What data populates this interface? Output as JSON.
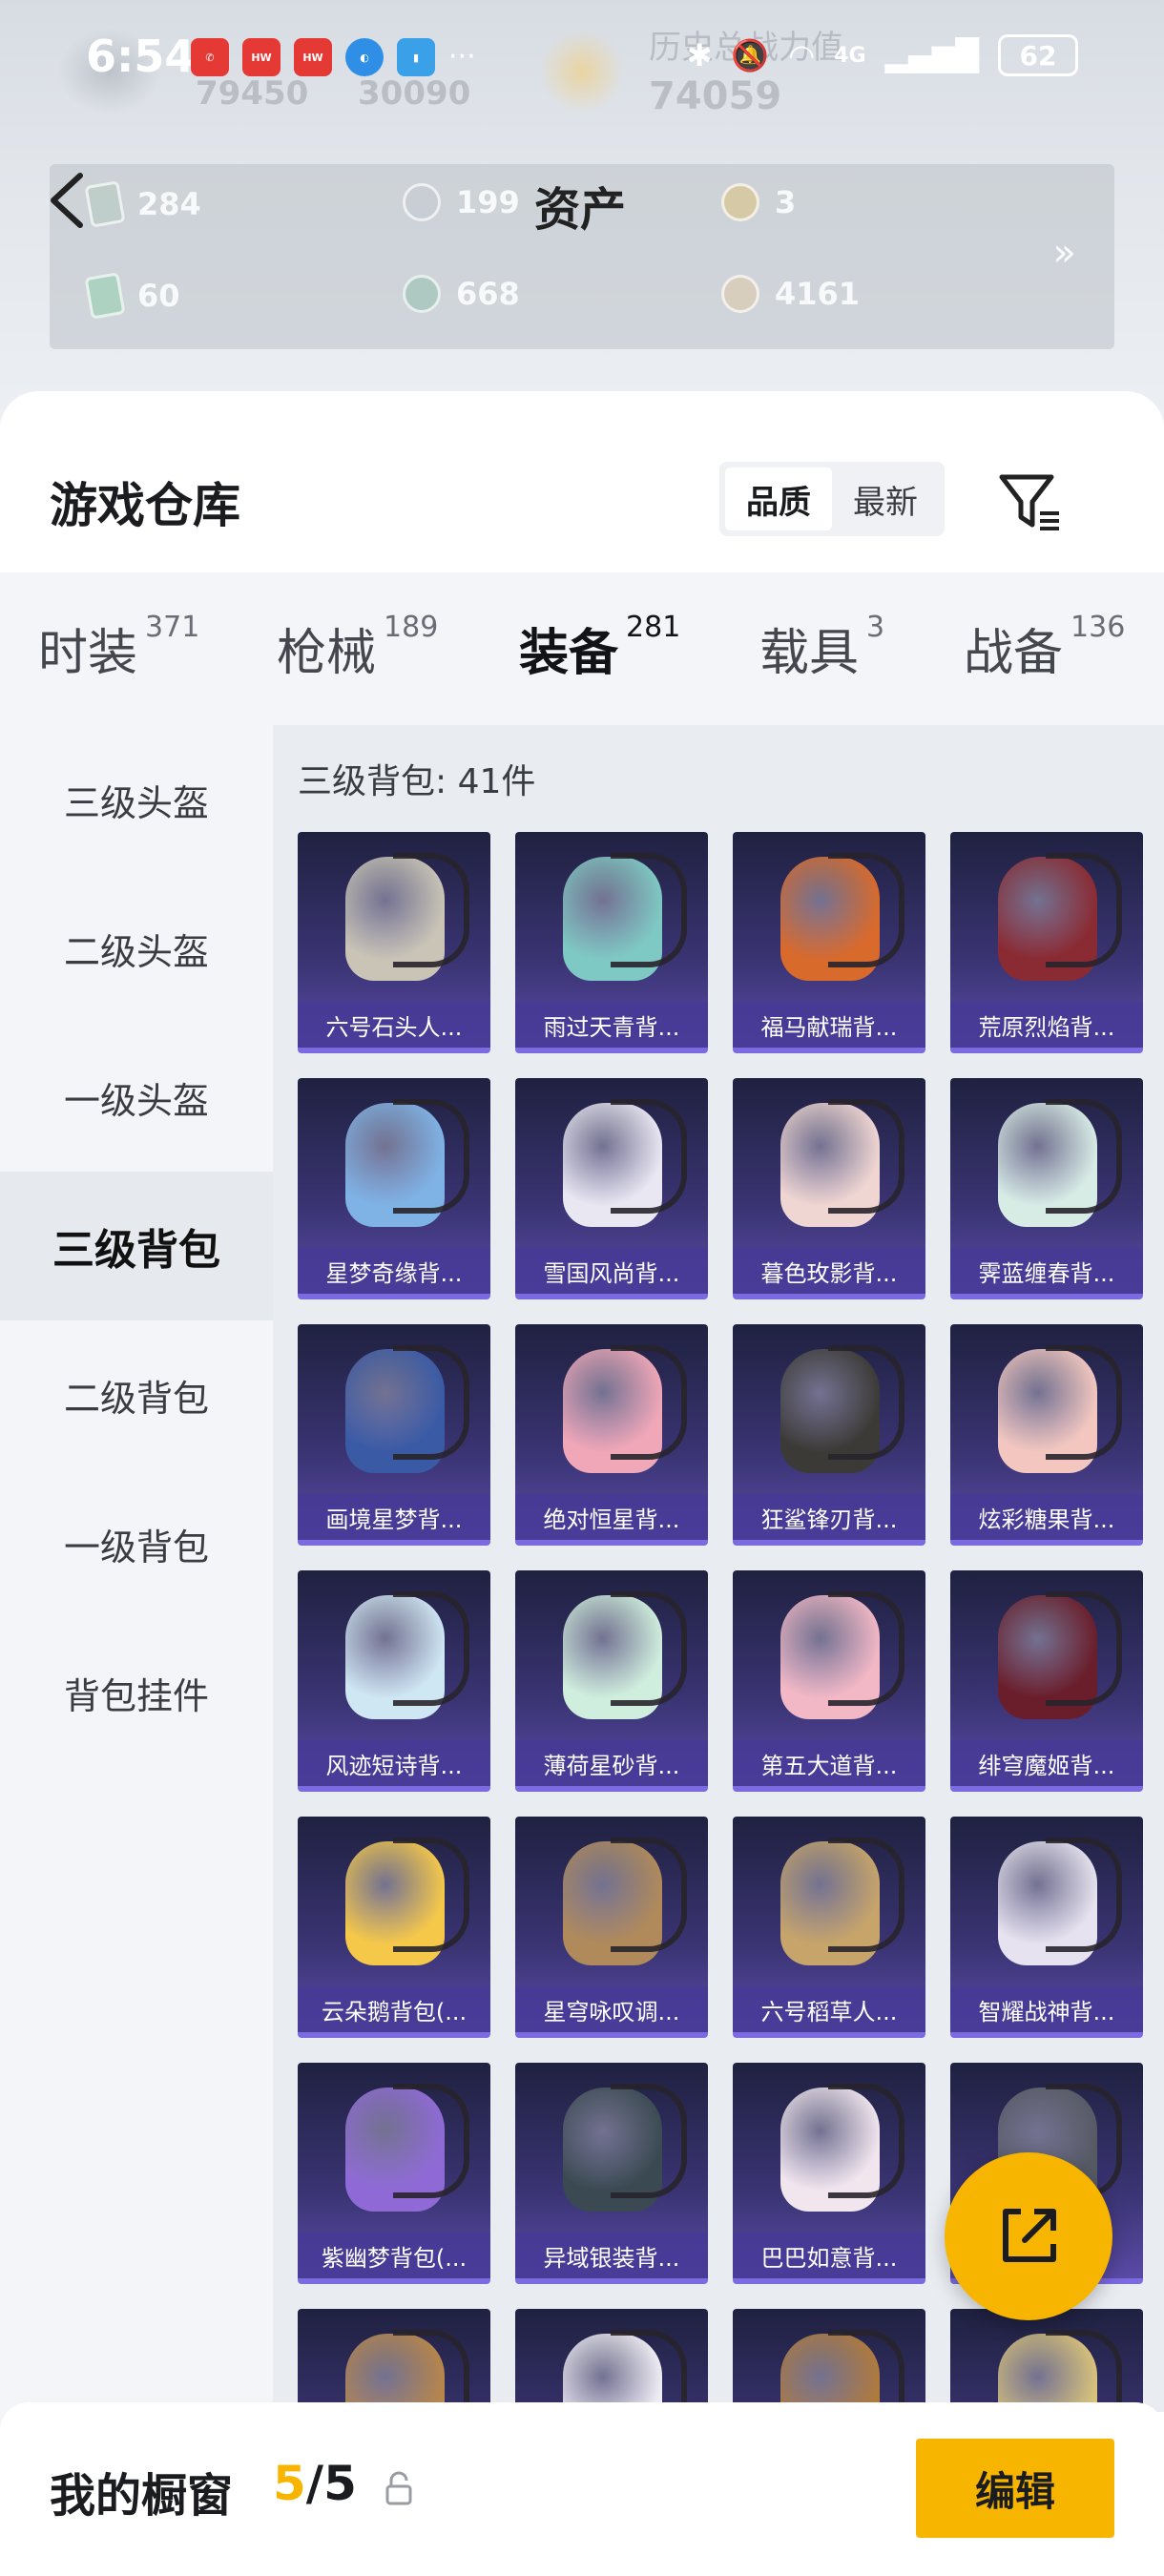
{
  "status_bar": {
    "time": "6:54",
    "battery": "62",
    "network": "4G"
  },
  "hero": {
    "title": "资产",
    "ghost_text_1": "历史总战力值",
    "ghost_text_2": "74059",
    "ghost_text_3": "79450",
    "ghost_text_4": "30090"
  },
  "assets": [
    {
      "value": "284",
      "icon": "card-icon"
    },
    {
      "value": "199",
      "icon": "coin-icon"
    },
    {
      "value": "3",
      "icon": "gold-coin-icon"
    },
    {
      "value": "60",
      "icon": "card-icon"
    },
    {
      "value": "668",
      "icon": "orb-icon"
    },
    {
      "value": "4161",
      "icon": "gold-coin-icon"
    }
  ],
  "warehouse": {
    "title": "游戏仓库",
    "sort_options": [
      "品质",
      "最新"
    ],
    "sort_selected": "品质"
  },
  "tabs": [
    {
      "label": "时装",
      "count": "371"
    },
    {
      "label": "枪械",
      "count": "189"
    },
    {
      "label": "装备",
      "count": "281",
      "active": true
    },
    {
      "label": "载具",
      "count": "3"
    },
    {
      "label": "战备",
      "count": "136"
    }
  ],
  "categories": [
    {
      "label": "三级头盔"
    },
    {
      "label": "二级头盔"
    },
    {
      "label": "一级头盔"
    },
    {
      "label": "三级背包",
      "active": true
    },
    {
      "label": "二级背包"
    },
    {
      "label": "一级背包"
    },
    {
      "label": "背包挂件"
    }
  ],
  "grid": {
    "heading": "三级背包: 41件",
    "items": [
      {
        "name": "六号石头人...",
        "color": "#c9c4b6"
      },
      {
        "name": "雨过天青背...",
        "color": "#7fc9c4"
      },
      {
        "name": "福马献瑞背...",
        "color": "#d86a2c"
      },
      {
        "name": "荒原烈焰背...",
        "color": "#8a2a32"
      },
      {
        "name": "星梦奇缘背...",
        "color": "#7fb3e6"
      },
      {
        "name": "雪国风尚背...",
        "color": "#e9e7f2"
      },
      {
        "name": "暮色玫影背...",
        "color": "#f0d6d2"
      },
      {
        "name": "霁蓝缠春背...",
        "color": "#d8ece6"
      },
      {
        "name": "画境星梦背...",
        "color": "#3a5aa6"
      },
      {
        "name": "绝对恒星背...",
        "color": "#f0a7b8"
      },
      {
        "name": "狂鲨锋刃背...",
        "color": "#3c3a36"
      },
      {
        "name": "炫彩糖果背...",
        "color": "#f3c7c0"
      },
      {
        "name": "风迹短诗背...",
        "color": "#cfe6f3"
      },
      {
        "name": "薄荷星砂背...",
        "color": "#cfeedd"
      },
      {
        "name": "第五大道背...",
        "color": "#f2b8c6"
      },
      {
        "name": "绯穹魔姬背...",
        "color": "#6a1d2a"
      },
      {
        "name": "云朵鹅背包(...",
        "color": "#f5c84a"
      },
      {
        "name": "星穹咏叹调...",
        "color": "#b08a5a"
      },
      {
        "name": "六号稻草人...",
        "color": "#c6a46a"
      },
      {
        "name": "智耀战神背...",
        "color": "#e6e2ef"
      },
      {
        "name": "紫幽梦背包(...",
        "color": "#8f6ad6"
      },
      {
        "name": "异域银装背...",
        "color": "#3b4a52"
      },
      {
        "name": "巴巴如意背...",
        "color": "#f1e6ee"
      },
      {
        "name": "",
        "color": "#565a64"
      },
      {
        "name": "",
        "color": "#b8864a"
      },
      {
        "name": "",
        "color": "#f0eef4"
      },
      {
        "name": "",
        "color": "#b07a3c"
      },
      {
        "name": "",
        "color": "#d8c27a"
      }
    ]
  },
  "bottom_bar": {
    "title": "我的橱窗",
    "count_current": "5",
    "count_separator": "/",
    "count_max": "5",
    "edit_label": "编辑"
  },
  "colors": {
    "accent": "#f7b500",
    "item_bg": "#3a3473",
    "item_label_bg": "#463a96"
  }
}
